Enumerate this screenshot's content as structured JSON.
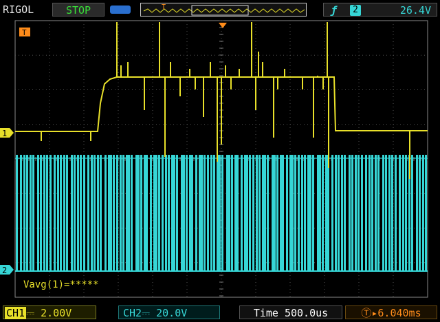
{
  "header": {
    "brand": "RIGOL",
    "run_state": "STOP",
    "trigger_panel": {
      "edge_icon": "rising-edge-icon",
      "source": "2",
      "level": "26.4V"
    }
  },
  "markers": {
    "trigger_position": "T",
    "ch1": "1",
    "ch2": "2"
  },
  "measurement": {
    "label": "Vavg(1)=*****"
  },
  "footer": {
    "ch1_label": "CH1",
    "ch1_scale": "2.00V",
    "ch2_label": "CH2",
    "ch2_scale": "20.0V",
    "time_label": "Time",
    "time_value": "500.0us",
    "trigger_offset": "6.040ms"
  },
  "colors": {
    "ch1": "#e8e02a",
    "ch2": "#36d6d6",
    "trigger": "#ff8c1a"
  }
}
